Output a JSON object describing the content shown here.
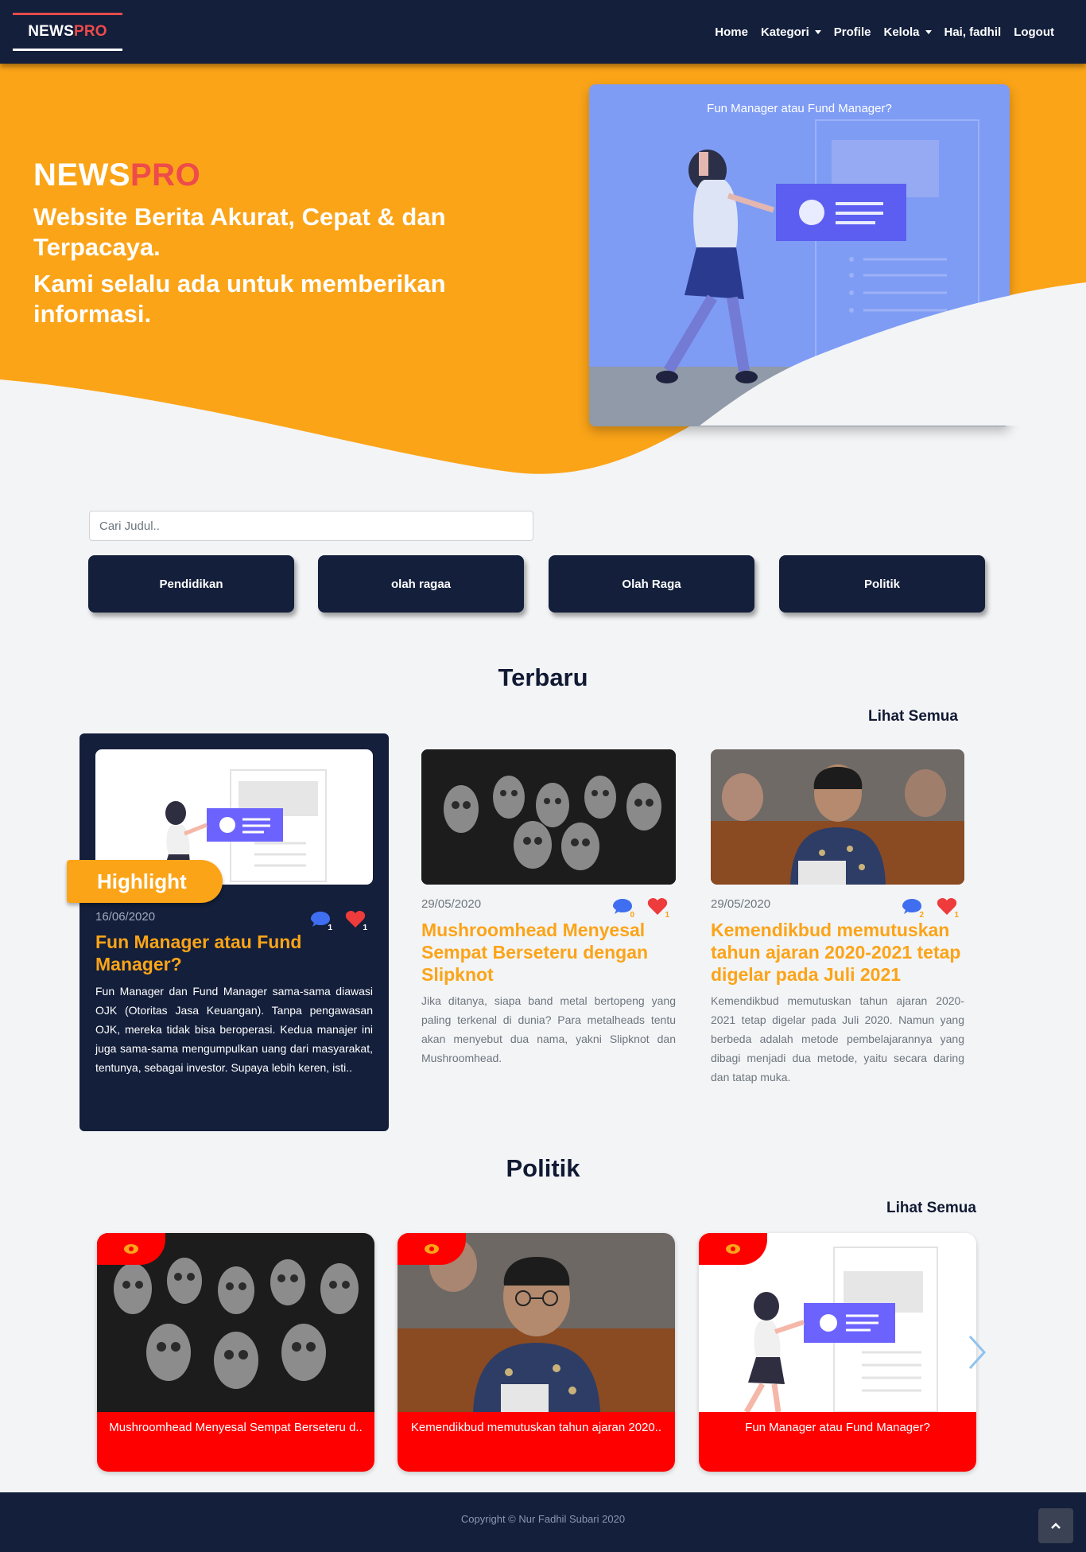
{
  "navbar": {
    "brand_part1": "NEWS",
    "brand_part2": "PRO",
    "links": [
      {
        "label": "Home"
      },
      {
        "label": "Kategori"
      },
      {
        "label": "Profile"
      },
      {
        "label": "Kelola"
      },
      {
        "label": "Hai, fadhil"
      },
      {
        "label": "Logout"
      }
    ]
  },
  "hero": {
    "brand_part1": "NEWS",
    "brand_part2": "PRO",
    "tagline1": "Website Berita Akurat, Cepat & dan Terpacaya.",
    "tagline2": "Kami selalu ada untuk memberikan informasi.",
    "slide_title": "Fun Manager atau Fund Manager?",
    "colors": {
      "accent": "#fba418",
      "navy": "#131f3b",
      "brand_red": "#ee4b4b"
    }
  },
  "search": {
    "placeholder": "Cari Judul.."
  },
  "categories": [
    {
      "label": "Pendidikan"
    },
    {
      "label": "olah ragaa"
    },
    {
      "label": "Olah Raga"
    },
    {
      "label": "Politik"
    }
  ],
  "terbaru": {
    "title": "Terbaru",
    "see_all": "Lihat Semua",
    "highlight_label": "Highlight",
    "posts": [
      {
        "date": "16/06/2020",
        "title": "Fun Manager atau Fund Manager?",
        "excerpt": "Fun Manager dan Fund Manager sama-sama diawasi OJK (Otoritas Jasa Keuangan). Tanpa pengawasan OJK, mereka tidak bisa beroperasi. Kedua manajer ini juga sama-sama mengumpulkan uang dari masyarakat, tentunya, sebagai investor. Supaya lebih keren, isti..",
        "comments": "1",
        "likes": "1",
        "image": "illustration-woman-card"
      },
      {
        "date": "29/05/2020",
        "title": "Mushroomhead Menyesal Sempat Berseteru dengan Slipknot",
        "excerpt": "Jika ditanya, siapa band metal bertopeng yang paling terkenal di dunia? Para metalheads tentu akan menyebut dua nama, yakni Slipknot dan Mushroomhead.",
        "comments": "0",
        "likes": "1",
        "image": "masked-band-photo"
      },
      {
        "date": "29/05/2020",
        "title": "Kemendikbud memutuskan tahun ajaran 2020-2021 tetap digelar pada Juli 2021",
        "excerpt": "Kemendikbud memutuskan tahun ajaran 2020-2021 tetap digelar pada Juli 2020. Namun yang berbeda adalah metode pembelajarannya yang dibagi menjadi dua metode, yaitu secara daring dan tatap muka.",
        "comments": "2",
        "likes": "1",
        "image": "minister-photo"
      }
    ]
  },
  "politik": {
    "title": "Politik",
    "see_all": "Lihat Semua",
    "cards": [
      {
        "caption": "Mushroomhead Menyesal Sempat Berseteru d..",
        "image": "masked-band-photo"
      },
      {
        "caption": "Kemendikbud memutuskan tahun ajaran 2020..",
        "image": "minister-photo"
      },
      {
        "caption": "Fun Manager atau Fund Manager?",
        "image": "illustration-woman-card"
      }
    ]
  },
  "footer": {
    "copyright": "Copyright © Nur Fadhil Subari 2020"
  },
  "icons": {
    "comment": "comment-icon",
    "like": "heart-icon",
    "views": "eye-icon",
    "next": "chevron-right-icon",
    "to_top": "chevron-up-icon"
  }
}
